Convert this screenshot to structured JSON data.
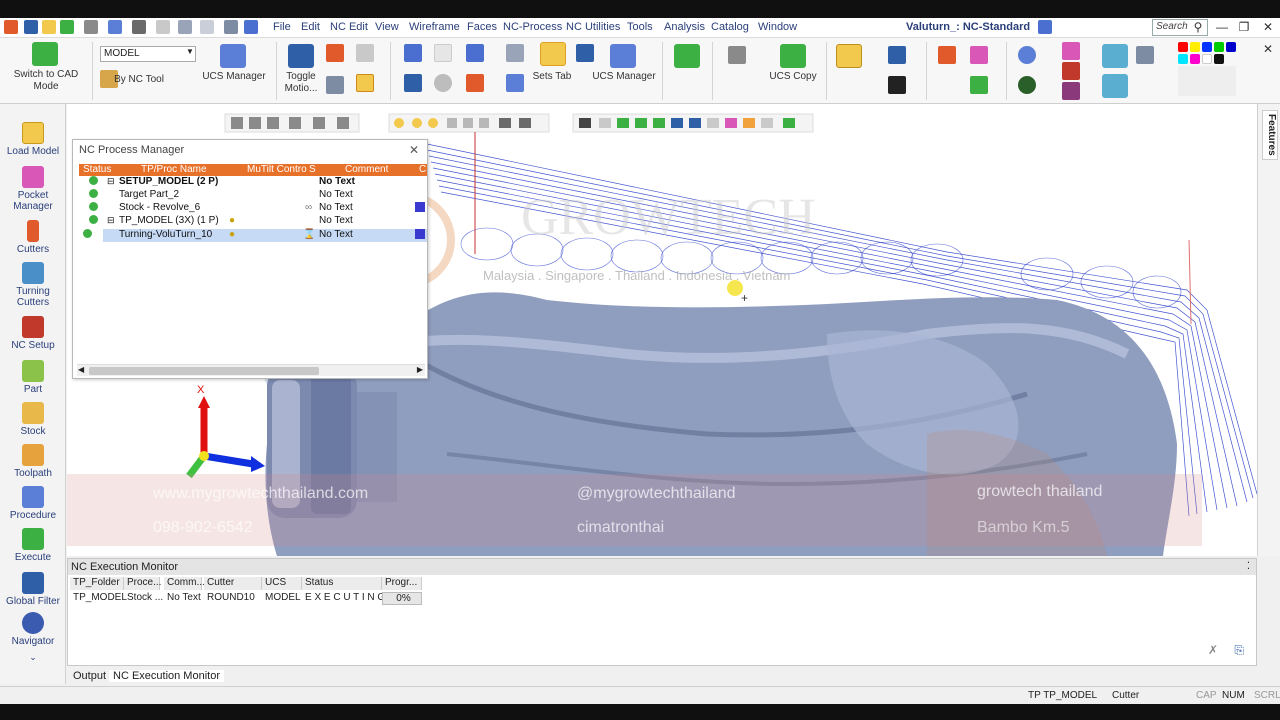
{
  "titlebar": {
    "menu": [
      "File",
      "Edit",
      "NC Edit",
      "View",
      "Wireframe",
      "Faces",
      "NC-Process",
      "NC Utilities",
      "Tools",
      "Analysis",
      "Catalog",
      "Window"
    ],
    "app_title": "Valuturn_: NC-Standard",
    "search_placeholder": "Search"
  },
  "ribbon": {
    "switch_to_cad": "Switch to CAD Mode",
    "model_value": "MODEL",
    "by_nc_tool": "By NC Tool",
    "ucs_manager_1": "UCS Manager",
    "toggle_motion": "Toggle Motio...",
    "sets_tab": "Sets Tab",
    "ucs_manager_2": "UCS Manager",
    "ucs_copy": "UCS Copy"
  },
  "leftbar": [
    {
      "label": "Load Model",
      "icon": "load-model-icon",
      "color": "#f2c94c"
    },
    {
      "label": "Pocket Manager",
      "icon": "pocket-manager-icon",
      "color": "#d957b6"
    },
    {
      "label": "Cutters",
      "icon": "cutters-icon",
      "color": "#e05a2b"
    },
    {
      "label": "Turning Cutters",
      "icon": "turning-cutters-icon",
      "color": "#4a8fc7"
    },
    {
      "label": "NC Setup",
      "icon": "nc-setup-icon",
      "color": "#c0392b"
    },
    {
      "label": "Part",
      "icon": "part-icon",
      "color": "#8bc34a"
    },
    {
      "label": "Stock",
      "icon": "stock-icon",
      "color": "#e8b84a"
    },
    {
      "label": "Toolpath",
      "icon": "toolpath-icon",
      "color": "#e6a23c"
    },
    {
      "label": "Procedure",
      "icon": "procedure-icon",
      "color": "#5b7fd6"
    },
    {
      "label": "Execute",
      "icon": "execute-icon",
      "color": "#3cb043"
    },
    {
      "label": "Global Filter",
      "icon": "global-filter-icon",
      "color": "#2f5fa7"
    },
    {
      "label": "Navigator",
      "icon": "navigator-icon",
      "color": "#3b5bb0"
    }
  ],
  "right_tab": "Features",
  "nc_process_manager": {
    "title": "NC Process Manager",
    "columns": [
      "Status",
      "TP/Proc Name",
      "MuTilt Contro",
      "S",
      "Comment",
      "C"
    ],
    "rows": [
      {
        "name": "SETUP_MODEL (2 P)",
        "comment": "No Text",
        "bold": true
      },
      {
        "name": "Target Part_2",
        "comment": "No Text",
        "bold": false
      },
      {
        "name": "Stock - Revolve_6",
        "comment": "No Text",
        "bold": false
      },
      {
        "name": "TP_MODEL (3X) (1 P)",
        "comment": "No Text",
        "bold": false
      },
      {
        "name": "Turning-VoluTurn_10",
        "comment": "No Text",
        "bold": false
      }
    ]
  },
  "watermark": {
    "brand": "GROWTECH",
    "countries": "Malaysia . Singapore . Thailand . Indonesia . Vietnam",
    "website": "www.mygrowtechthailand.com",
    "line": "@mygrowtechthailand",
    "facebook": "growtech thailand",
    "phone": "098-902-6542",
    "fb_page": "cimatronthai",
    "other": "Bambo Km.5"
  },
  "axis": {
    "x_label": "X"
  },
  "execution_monitor": {
    "title": "NC Execution Monitor",
    "columns": [
      "TP_Folder",
      "Proce...",
      "Comm...",
      "Cutter",
      "UCS",
      "Status",
      "Progr..."
    ],
    "row": [
      "TP_MODEL",
      "Stock ...",
      "No Text",
      "ROUND10",
      "MODEL",
      "E X E C U T I N G",
      "0%"
    ],
    "progress": 0
  },
  "bottom_tabs": [
    "Output",
    "NC Execution Monitor"
  ],
  "statusbar": {
    "tp": "TP  TP_MODEL",
    "cutter": "Cutter",
    "cap": "CAP",
    "num": "NUM",
    "scrl": "SCRL"
  }
}
